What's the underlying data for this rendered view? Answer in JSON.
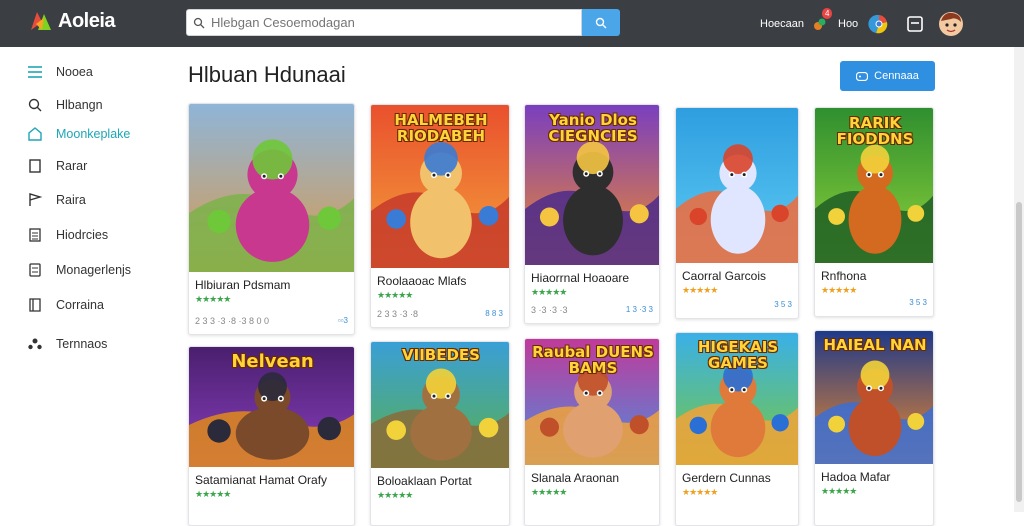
{
  "app": {
    "name": "Aoleia",
    "brand_colors": [
      "#e74c3c",
      "#f5a623",
      "#7ed321"
    ]
  },
  "search": {
    "placeholder": "Hlebgan Cesoemodagan",
    "value": ""
  },
  "topbar": {
    "label_left": "Hoecaan",
    "notif_count": "4",
    "label_mid": "Hoo",
    "icons": [
      "notification-icon",
      "chrome-icon",
      "exit-icon",
      "avatar"
    ]
  },
  "sidebar": {
    "items": [
      {
        "label": "Nooea",
        "icon": "menu-icon",
        "active": false
      },
      {
        "label": "Hlbangn",
        "icon": "search-icon",
        "active": false
      },
      {
        "label": "Moonkeplake",
        "icon": "home-icon",
        "active": true
      },
      {
        "label": "Rarar",
        "icon": "doc-icon",
        "active": false
      },
      {
        "label": "Raira",
        "icon": "flag-icon",
        "active": false
      },
      {
        "label": "Hiodrcies",
        "icon": "list-icon",
        "active": false
      },
      {
        "label": "Monagerlenjs",
        "icon": "list-alt-icon",
        "active": false
      },
      {
        "label": "Corraina",
        "icon": "book-icon",
        "active": false
      },
      {
        "label": "Ternnaos",
        "icon": "people-icon",
        "active": false
      }
    ]
  },
  "main": {
    "title": "Hlbuan Hdunaai",
    "create_button": "Cennaaa"
  },
  "cards": [
    {
      "title": "Hlbiuran Pdsmam",
      "stars": "★★★★★",
      "meta": "2 3 3 ·3 ·8 ·3 8 0 0",
      "badge": "▫▫3",
      "banner": "",
      "theme": "mountain"
    },
    {
      "title": "Roolaaoac Mlafs",
      "stars": "★★★★★",
      "meta": "2 3 3 ·3 ·8",
      "badge": "8 8 3",
      "banner": "HALMEBEH RIODABEH",
      "theme": "red"
    },
    {
      "title": "Hiaorrnal Hoaoare",
      "stars": "★★★★★",
      "meta": "3 ·3 ·3 ·3",
      "badge": "1 3 ·3 3",
      "banner": "Yanio Dlos CIEGNCIES",
      "theme": "purple"
    },
    {
      "title": "Caorral Garcois",
      "stars": "★★★★★",
      "meta": "",
      "badge": "3 5 3",
      "banner": "",
      "theme": "blue"
    },
    {
      "title": "Rnfhona",
      "stars": "★★★★★",
      "meta": "",
      "badge": "3 5 3",
      "banner": "RARIK FIODDNS",
      "theme": "green"
    },
    {
      "title": "Satamianat Hamat Orafy",
      "stars": "★★★★★",
      "meta": "",
      "badge": "",
      "banner": "Nelvean",
      "theme": "violet"
    },
    {
      "title": "Boloaklaan Portat",
      "stars": "★★★★★",
      "meta": "",
      "badge": "",
      "banner": "VIIBEDES",
      "theme": "forest"
    },
    {
      "title": "Slanala Araonan",
      "stars": "★★★★★",
      "meta": "",
      "badge": "",
      "banner": "Raubal DUENS BAMS",
      "theme": "magenta"
    },
    {
      "title": "Gerdern Cunnas",
      "stars": "★★★★★",
      "meta": "",
      "badge": "",
      "banner": "HIGEKAIS GAMES",
      "theme": "sky"
    },
    {
      "title": "Hadoa Mafar",
      "stars": "★★★★★",
      "meta": "",
      "badge": "",
      "banner": "HAIEAL NAN",
      "theme": "night"
    }
  ]
}
